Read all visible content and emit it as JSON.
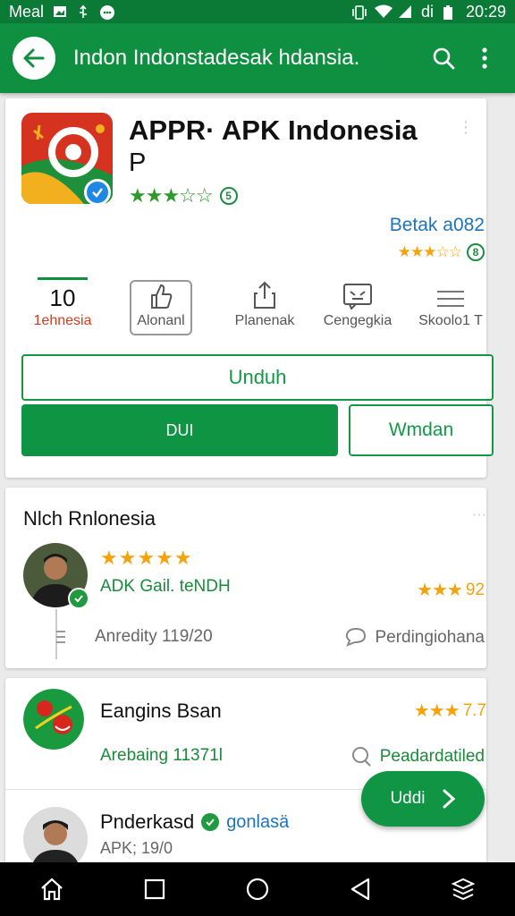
{
  "status_bar": {
    "carrier": "Meal",
    "time": "20:29",
    "signal_text": "di"
  },
  "app_bar": {
    "title": "Indon Indonstadesak hdansia."
  },
  "app": {
    "title_line1": "APPR· APK Indonesia",
    "title_line2": "P",
    "stars": "★★★☆☆",
    "rating_count": "5",
    "beta_label": "Betak a082",
    "beta_stars": "★★★☆☆",
    "beta_count": "8"
  },
  "stats": [
    {
      "value": "10",
      "label": "1ehnesia",
      "icon": "number"
    },
    {
      "label": "Alonanl",
      "icon": "thumb-up-icon"
    },
    {
      "label": "Planenak",
      "icon": "share-icon"
    },
    {
      "label": "Cengegkia",
      "icon": "message-icon"
    },
    {
      "label": "Skoolo1 T",
      "icon": "list-icon"
    }
  ],
  "buttons": {
    "primary_outline": "Unduh",
    "filled": "DUI",
    "secondary_outline": "Wmdan"
  },
  "reviews_section": {
    "title": "Nlch Rnlonesia",
    "menu": "···"
  },
  "review1": {
    "stars": "★★★★★",
    "name": "ADK Gail. teNDH",
    "score_stars": "★★★",
    "score": "92",
    "date": "Anredity 119/20",
    "reply": "Perdingiohana"
  },
  "card3": {
    "item1_title": "Eangins Bsan",
    "item1_score_stars": "★★★",
    "item1_score": "7.7",
    "item1_sub": "Arebaing 11371l",
    "item1_reply": "Peadardatiled",
    "item2_name": "Pnderkasd",
    "item2_badge_text": "gonlasä",
    "item2_sub": "APK; 19/0"
  },
  "fab": {
    "label": "Uddi"
  },
  "colors": {
    "primary": "#0f8f40",
    "accent_star": "#f4a30c",
    "link_blue": "#1e73be"
  }
}
